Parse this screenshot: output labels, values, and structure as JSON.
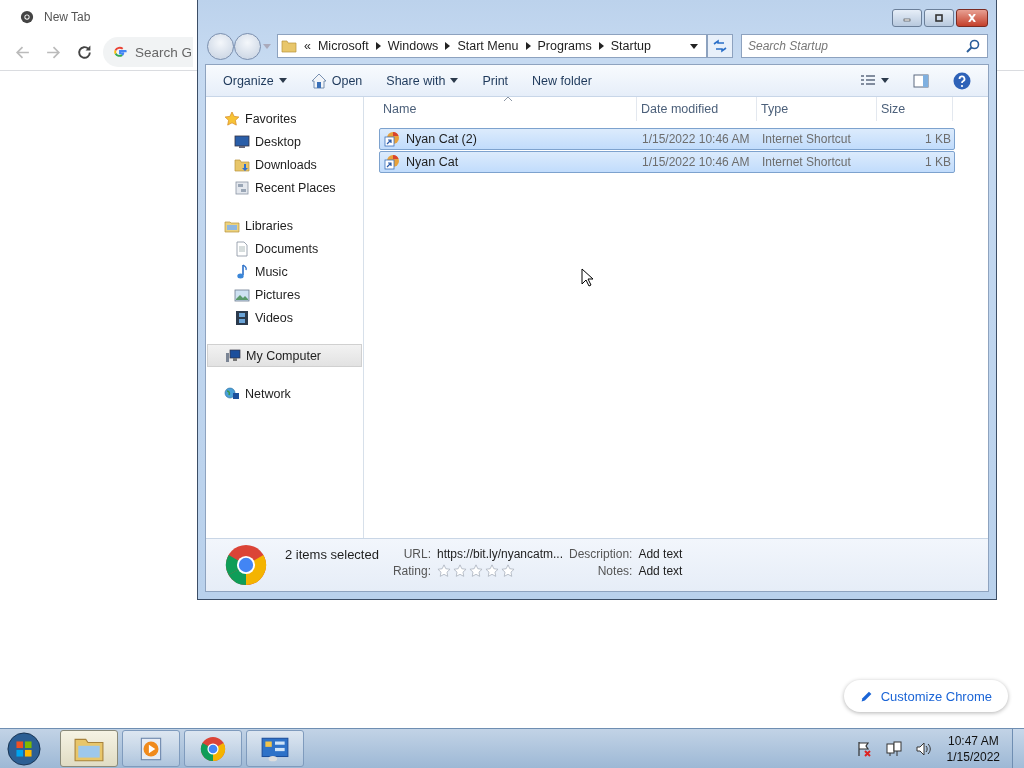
{
  "browser": {
    "tab": {
      "title": "New Tab"
    },
    "omnibox": {
      "placeholder": "Search G"
    },
    "customize_button": "Customize Chrome"
  },
  "explorer": {
    "address": {
      "overflow": "«",
      "crumbs": [
        "Microsoft",
        "Windows",
        "Start Menu",
        "Programs",
        "Startup"
      ]
    },
    "search": {
      "placeholder": "Search Startup"
    },
    "commands": [
      {
        "label": "Organize",
        "kind": "dropdown"
      },
      {
        "label": "Open",
        "kind": "icon"
      },
      {
        "label": "Share with",
        "kind": "dropdown"
      },
      {
        "label": "Print",
        "kind": "plain"
      },
      {
        "label": "New folder",
        "kind": "plain"
      }
    ],
    "nav": [
      {
        "label": "Favorites",
        "selected": false,
        "children": [
          {
            "label": "Desktop",
            "selected": false
          },
          {
            "label": "Downloads",
            "selected": false
          },
          {
            "label": "Recent Places",
            "selected": false
          }
        ]
      },
      {
        "label": "Libraries",
        "selected": false,
        "children": [
          {
            "label": "Documents",
            "selected": false
          },
          {
            "label": "Music",
            "selected": false
          },
          {
            "label": "Pictures",
            "selected": false
          },
          {
            "label": "Videos",
            "selected": false
          }
        ]
      },
      {
        "label": "My Computer",
        "selected": true
      },
      {
        "label": "Network",
        "selected": false
      }
    ],
    "columns": [
      {
        "label": "Name",
        "sorted": true
      },
      {
        "label": "Date modified",
        "sorted": false
      },
      {
        "label": "Type",
        "sorted": false
      },
      {
        "label": "Size",
        "sorted": false
      }
    ],
    "files": [
      {
        "name": "Nyan Cat (2)",
        "date": "1/15/2022 10:46 AM",
        "type": "Internet Shortcut",
        "size": "1 KB",
        "selected": true
      },
      {
        "name": "Nyan Cat",
        "date": "1/15/2022 10:46 AM",
        "type": "Internet Shortcut",
        "size": "1 KB",
        "selected": true
      }
    ],
    "details": {
      "summary": "2 items selected",
      "fields": [
        {
          "label": "URL:",
          "kind": "text",
          "value": "https://bit.ly/nyancatm..."
        },
        {
          "label": "Description:",
          "kind": "text",
          "value": "Add text"
        },
        {
          "label": "Rating:",
          "kind": "stars",
          "stars": 0
        },
        {
          "label": "Notes:",
          "kind": "text",
          "value": "Add text"
        }
      ]
    }
  },
  "taskbar": {
    "buttons": [
      {
        "selected": true
      },
      {
        "selected": false
      },
      {
        "selected": false
      },
      {
        "selected": false
      }
    ],
    "clock": {
      "time": "10:47 AM",
      "date": "1/15/2022"
    }
  }
}
